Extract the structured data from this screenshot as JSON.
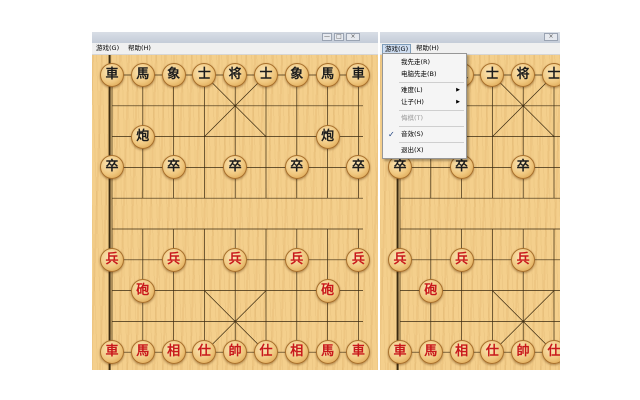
{
  "left_window": {
    "menus": [
      "游戏(G)",
      "帮助(H)"
    ],
    "buttons": [
      "—",
      "□",
      "×"
    ]
  },
  "right_window": {
    "menus": [
      "游戏(G)",
      "帮助(H)"
    ],
    "buttons": [
      "×"
    ]
  },
  "dropdown": {
    "items": [
      {
        "label": "我先走(R)"
      },
      {
        "label": "电脑先走(B)"
      },
      {
        "label": "难度(L)",
        "submenu": true
      },
      {
        "label": "让子(H)",
        "submenu": true
      },
      {
        "label": "悔棋(T)",
        "disabled": true
      },
      {
        "label": "音效(S)",
        "checked": true
      },
      {
        "label": "退出(X)"
      }
    ]
  },
  "colors": {
    "black_piece_text": "#1c1c1c",
    "red_piece_text": "#c8181b",
    "board": "#f4cf8c"
  },
  "pieces": {
    "black": [
      {
        "char": "車",
        "col": 0,
        "row": 0
      },
      {
        "char": "馬",
        "col": 1,
        "row": 0
      },
      {
        "char": "象",
        "col": 2,
        "row": 0
      },
      {
        "char": "士",
        "col": 3,
        "row": 0
      },
      {
        "char": "将",
        "col": 4,
        "row": 0
      },
      {
        "char": "士",
        "col": 5,
        "row": 0
      },
      {
        "char": "象",
        "col": 6,
        "row": 0
      },
      {
        "char": "馬",
        "col": 7,
        "row": 0
      },
      {
        "char": "車",
        "col": 8,
        "row": 0
      },
      {
        "char": "炮",
        "col": 1,
        "row": 2
      },
      {
        "char": "炮",
        "col": 7,
        "row": 2
      },
      {
        "char": "卒",
        "col": 0,
        "row": 3
      },
      {
        "char": "卒",
        "col": 2,
        "row": 3
      },
      {
        "char": "卒",
        "col": 4,
        "row": 3
      },
      {
        "char": "卒",
        "col": 6,
        "row": 3
      },
      {
        "char": "卒",
        "col": 8,
        "row": 3
      }
    ],
    "red": [
      {
        "char": "兵",
        "col": 0,
        "row": 6
      },
      {
        "char": "兵",
        "col": 2,
        "row": 6
      },
      {
        "char": "兵",
        "col": 4,
        "row": 6
      },
      {
        "char": "兵",
        "col": 6,
        "row": 6
      },
      {
        "char": "兵",
        "col": 8,
        "row": 6
      },
      {
        "char": "砲",
        "col": 1,
        "row": 7
      },
      {
        "char": "砲",
        "col": 7,
        "row": 7
      },
      {
        "char": "車",
        "col": 0,
        "row": 9
      },
      {
        "char": "馬",
        "col": 1,
        "row": 9
      },
      {
        "char": "相",
        "col": 2,
        "row": 9
      },
      {
        "char": "仕",
        "col": 3,
        "row": 9
      },
      {
        "char": "帥",
        "col": 4,
        "row": 9
      },
      {
        "char": "仕",
        "col": 5,
        "row": 9
      },
      {
        "char": "相",
        "col": 6,
        "row": 9
      },
      {
        "char": "馬",
        "col": 7,
        "row": 9
      },
      {
        "char": "車",
        "col": 8,
        "row": 9
      }
    ]
  }
}
